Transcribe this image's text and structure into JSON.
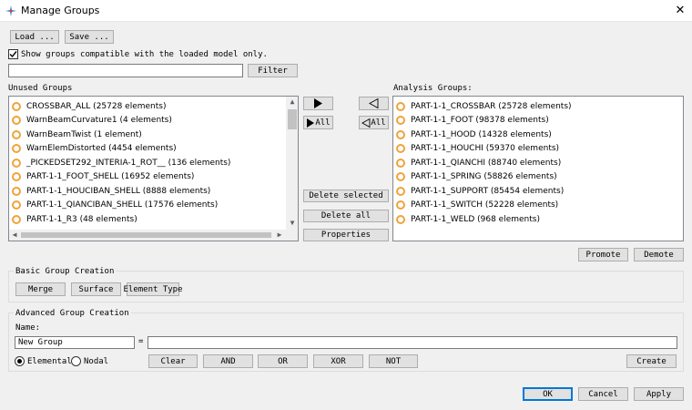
{
  "window": {
    "title": "Manage Groups",
    "close_glyph": "✕",
    "icon": "abaqus-icon"
  },
  "toolbar": {
    "load_label": "Load ...",
    "save_label": "Save ..."
  },
  "filter": {
    "checkbox_label": "Show groups compatible with the loaded model only.",
    "checked": true,
    "value": "",
    "button_label": "Filter"
  },
  "unused": {
    "title": "Unused Groups",
    "items": [
      "CROSSBAR_ALL (25728 elements)",
      "WarnBeamCurvature1 (4 elements)",
      "WarnBeamTwist (1 element)",
      "WarnElemDistorted (4454 elements)",
      "_PICKEDSET292_INTERIA-1_ROT__ (136 elements)",
      "PART-1-1_FOOT_SHELL (16952 elements)",
      "PART-1-1_HOUCIBAN_SHELL (8888 elements)",
      "PART-1-1_QIANCIBAN_SHELL (17576 elements)",
      "PART-1-1_R3 (48 elements)"
    ]
  },
  "transfer": {
    "add_label": "",
    "add_all_label": "All",
    "remove_label": "",
    "remove_all_label": "All",
    "delete_selected_label": "Delete selected",
    "delete_all_label": "Delete all",
    "properties_label": "Properties"
  },
  "analysis": {
    "title": "Analysis Groups:",
    "items": [
      "PART-1-1_CROSSBAR (25728 elements)",
      "PART-1-1_FOOT (98378 elements)",
      "PART-1-1_HOOD (14328 elements)",
      "PART-1-1_HOUCHI (59370 elements)",
      "PART-1-1_QIANCHI (88740 elements)",
      "PART-1-1_SPRING (58826 elements)",
      "PART-1-1_SUPPORT (85454 elements)",
      "PART-1-1_SWITCH (52228 elements)",
      "PART-1-1_WELD (968 elements)"
    ],
    "promote_label": "Promote",
    "demote_label": "Demote"
  },
  "basic": {
    "title": "Basic Group Creation",
    "merge_label": "Merge",
    "surface_label": "Surface",
    "element_type_label": "Element Type"
  },
  "advanced": {
    "title": "Advanced Group Creation",
    "name_label": "Name:",
    "name_value": "New Group",
    "equals": "=",
    "expression_value": "",
    "elemental_label": "Elemental",
    "nodal_label": "Nodal",
    "selected_mode": "Elemental",
    "clear_label": "Clear",
    "and_label": "AND",
    "or_label": "OR",
    "xor_label": "XOR",
    "not_label": "NOT",
    "create_label": "Create"
  },
  "footer": {
    "ok_label": "OK",
    "cancel_label": "Cancel",
    "apply_label": "Apply"
  },
  "colors": {
    "ring": "#f0a33a",
    "focus_border": "#0078d7"
  }
}
